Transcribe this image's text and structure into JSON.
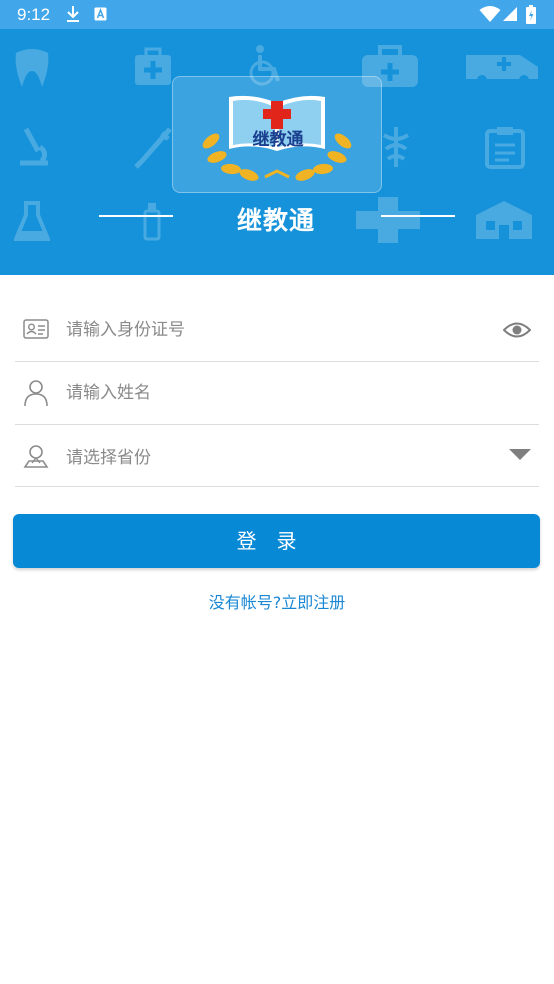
{
  "status_bar": {
    "time": "9:12",
    "icons": [
      "download-icon",
      "keyboard-a-icon",
      "wifi-icon",
      "signal-icon",
      "battery-charging-icon"
    ]
  },
  "header": {
    "logo_text": "继教通",
    "app_title": "继教通",
    "background_color": "#1592da",
    "background_icons": [
      "tooth-icon",
      "medical-kit-icon",
      "wheelchair-icon",
      "first-aid-bag-icon",
      "ambulance-icon",
      "microscope-icon",
      "syringe-icon",
      "caduceus-icon",
      "clipboard-icon",
      "flask-icon",
      "bottle-icon",
      "cross-icon",
      "hospital-icon"
    ]
  },
  "form": {
    "id_field": {
      "placeholder": "请输入身份证号",
      "value": "",
      "leading_icon": "id-card-icon",
      "trailing_icon": "eye-icon"
    },
    "name_field": {
      "placeholder": "请输入姓名",
      "value": "",
      "leading_icon": "person-icon"
    },
    "province_field": {
      "placeholder": "请选择省份",
      "leading_icon": "location-person-icon",
      "trailing_icon": "dropdown-arrow-icon"
    }
  },
  "login_button": {
    "label": "登录",
    "color": "#0789d6"
  },
  "register_link": {
    "label": "没有帐号?立即注册",
    "color": "#1a87d4"
  }
}
